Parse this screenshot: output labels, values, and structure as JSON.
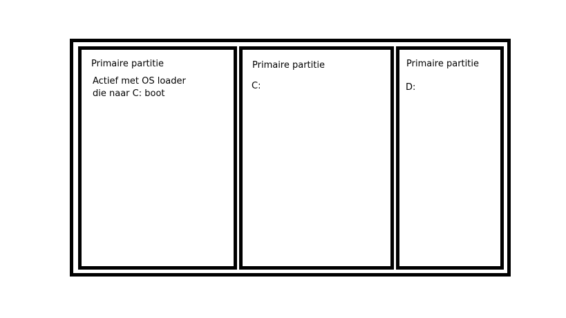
{
  "partitions": [
    {
      "title": "Primaire partitie",
      "description_lines": [
        "Actief met OS loader",
        "die naar C: boot"
      ]
    },
    {
      "title": "Primaire partitie",
      "drive": "C:"
    },
    {
      "title": "Primaire partitie",
      "drive": "D:"
    }
  ]
}
